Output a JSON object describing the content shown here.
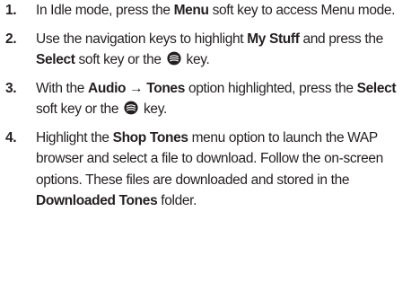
{
  "steps": [
    {
      "number": "1.",
      "parts": [
        "In Idle mode, press the ",
        "Menu",
        " soft key to access Menu mode."
      ]
    },
    {
      "number": "2.",
      "parts": [
        "Use the navigation keys to highlight ",
        "My Stuff",
        " and press the ",
        "Select",
        " soft key or the ",
        " key."
      ],
      "icon": "center-select-key-icon"
    },
    {
      "number": "3.",
      "parts": [
        "With the ",
        "Audio → Tones",
        " option highlighted, press the ",
        "Select",
        " soft key or the ",
        " key."
      ],
      "icon": "center-select-key-icon"
    },
    {
      "number": "4.",
      "parts": [
        "Highlight the ",
        "Shop Tones",
        " menu option to launch the WAP browser and select a file to download. Follow the on-screen options. These files are downloaded and stored in the ",
        "Downloaded Tones",
        " folder."
      ]
    }
  ]
}
